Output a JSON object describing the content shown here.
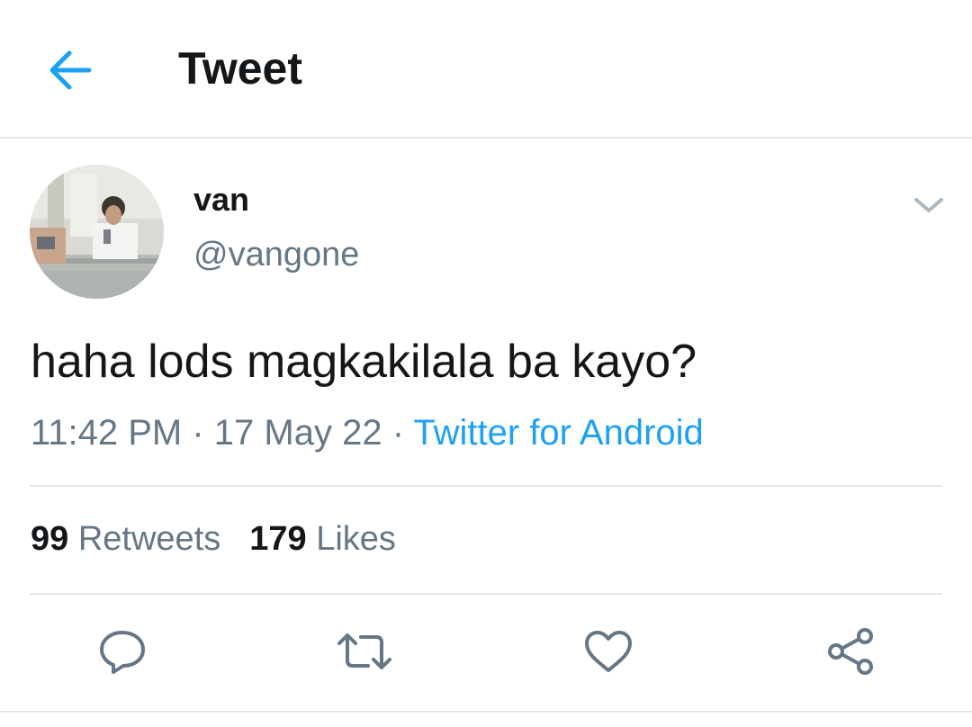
{
  "header": {
    "title": "Tweet",
    "back_icon": "arrow-left-icon"
  },
  "author": {
    "display_name": "van",
    "handle": "@vangone",
    "avatar_icon": "profile-photo"
  },
  "tweet": {
    "text": "haha lods magkakilala ba kayo?",
    "time": "11:42 PM",
    "date": "17 May 22",
    "separator": " · ",
    "source": "Twitter for Android"
  },
  "stats": {
    "retweets_count": "99",
    "retweets_label": "Retweets",
    "likes_count": "179",
    "likes_label": "Likes"
  },
  "actions": [
    "reply-icon",
    "retweet-icon",
    "like-icon",
    "share-icon"
  ],
  "colors": {
    "accent": "#1da1f2",
    "text_primary": "#14171a",
    "text_secondary": "#657786",
    "divider": "#e1e8ed",
    "icon_gray": "#657786"
  }
}
